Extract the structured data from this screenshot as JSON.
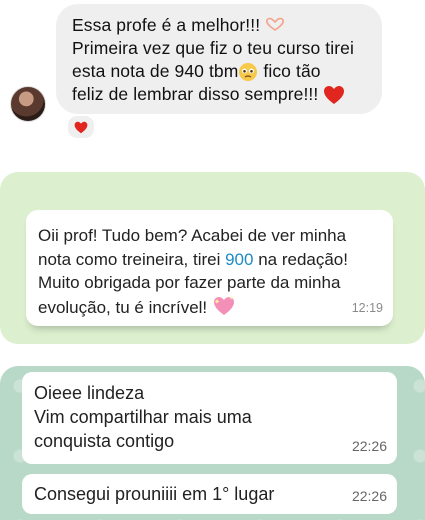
{
  "dm": {
    "lines": [
      "Essa profe é a melhor!!!",
      "Primeira vez que fiz o teu curso tirei",
      "esta nota de 940 tbm",
      " fico tão",
      "feliz de lembrar disso sempre!!!"
    ],
    "icons": [
      "heart-hands-emoji",
      "holding-back-tears-emoji",
      "red-heart-emoji",
      "red-heart-reaction"
    ]
  },
  "chat1": {
    "line1": "Oii prof! Tudo bem? Acabei de ver minha",
    "line2a": "nota como treineira, tirei ",
    "line2num": "900",
    "line2b": " na redação!",
    "line3": "Muito obrigada por fazer parte da minha",
    "line4": "evolução, tu é incrível!",
    "time": "12:19",
    "colors": {
      "background": "#dcf0cf",
      "highlight": "#1e8bc3"
    }
  },
  "chat2": {
    "messages": [
      {
        "lines": [
          "Oieee lindeza",
          "Vim compartilhar mais uma",
          "conquista contigo"
        ],
        "time": "22:26"
      },
      {
        "lines": [
          "Consegui prouniiii em 1° lugar"
        ],
        "time": "22:26"
      }
    ],
    "colors": {
      "background": "#b9d9c8"
    }
  }
}
